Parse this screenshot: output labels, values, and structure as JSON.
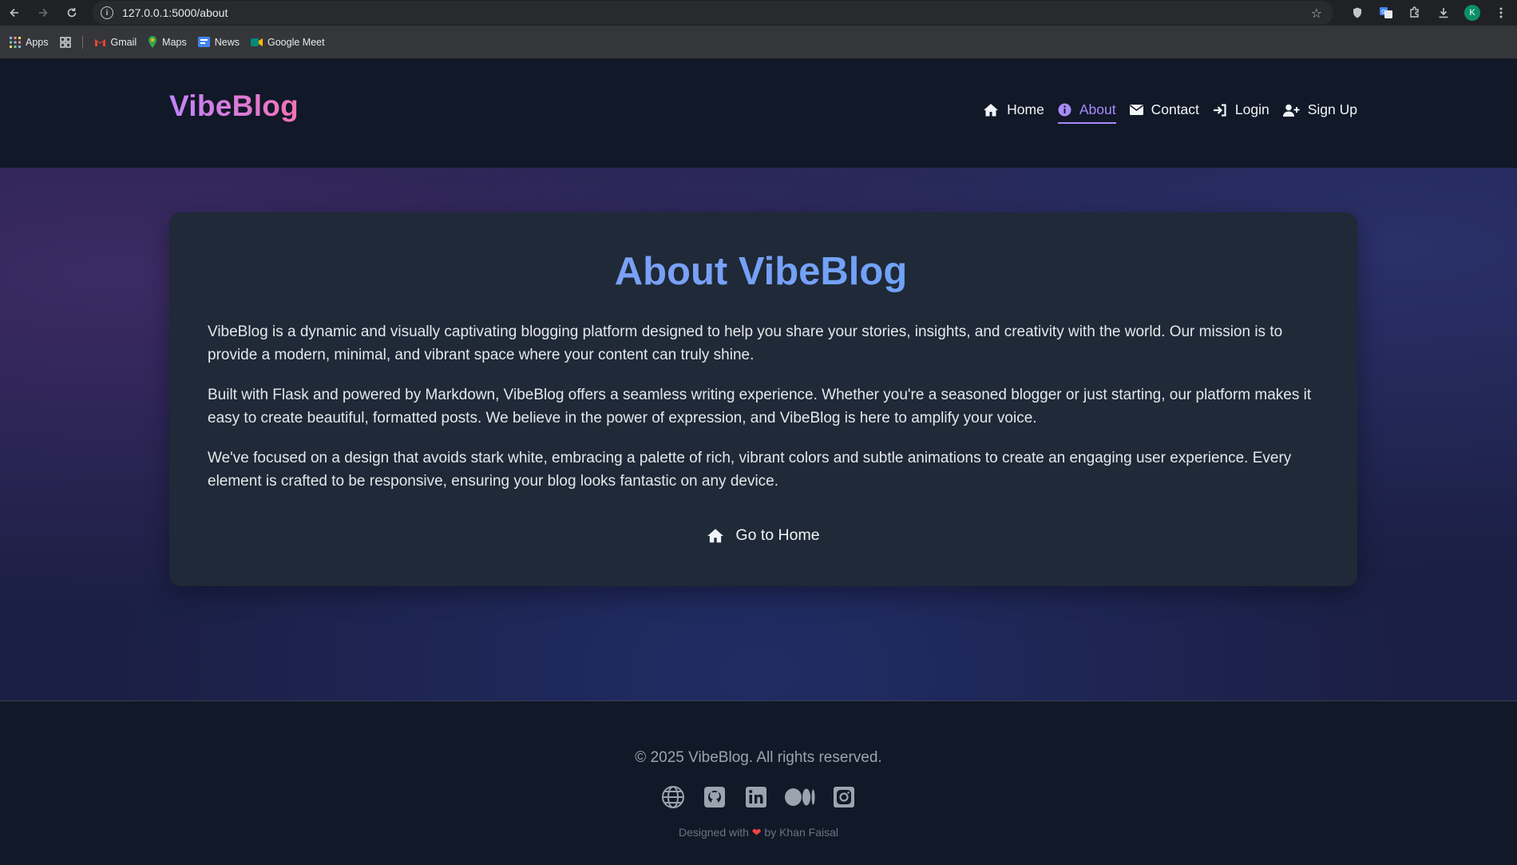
{
  "browser": {
    "url": "127.0.0.1:5000/about",
    "bookmarks": [
      {
        "label": "Apps",
        "icon": "apps-grid-icon"
      },
      {
        "label": "Gmail",
        "icon": "gmail-icon"
      },
      {
        "label": "Maps",
        "icon": "maps-icon"
      },
      {
        "label": "News",
        "icon": "news-icon"
      },
      {
        "label": "Google Meet",
        "icon": "meet-icon"
      }
    ],
    "profile_initial": "K"
  },
  "site": {
    "logo": "VibeBlog",
    "nav": [
      {
        "label": "Home",
        "icon": "home-icon",
        "active": false
      },
      {
        "label": "About",
        "icon": "info-icon",
        "active": true
      },
      {
        "label": "Contact",
        "icon": "envelope-icon",
        "active": false
      },
      {
        "label": "Login",
        "icon": "sign-in-icon",
        "active": false
      },
      {
        "label": "Sign Up",
        "icon": "user-plus-icon",
        "active": false
      }
    ],
    "accent": "#a78bfa"
  },
  "main": {
    "title": "About VibeBlog",
    "paragraphs": [
      "VibeBlog is a dynamic and visually captivating blogging platform designed to help you share your stories, insights, and creativity with the world. Our mission is to provide a modern, minimal, and vibrant space where your content can truly shine.",
      "Built with Flask and powered by Markdown, VibeBlog offers a seamless writing experience. Whether you're a seasoned blogger or just starting, our platform makes it easy to create beautiful, formatted posts. We believe in the power of expression, and VibeBlog is here to amplify your voice.",
      "We've focused on a design that avoids stark white, embracing a palette of rich, vibrant colors and subtle animations to create an engaging user experience. Every element is crafted to be responsive, ensuring your blog looks fantastic on any device."
    ],
    "home_button": "Go to Home"
  },
  "footer": {
    "copyright": "© 2025 VibeBlog. All rights reserved.",
    "socials": [
      "globe-icon",
      "github-icon",
      "linkedin-icon",
      "medium-icon",
      "instagram-icon"
    ],
    "credit_prefix": "Designed with",
    "credit_heart": "❤",
    "credit_suffix": "by Khan Faisal"
  }
}
